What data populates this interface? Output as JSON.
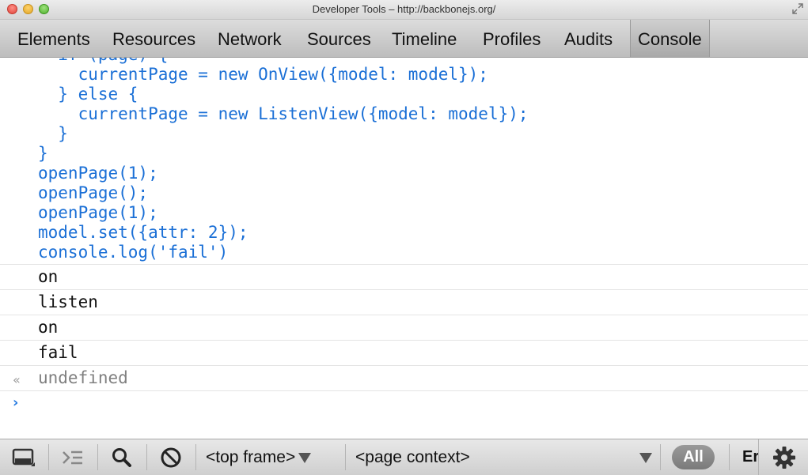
{
  "window": {
    "title": "Developer Tools – http://backbonejs.org/"
  },
  "tabs": [
    {
      "label": "Elements"
    },
    {
      "label": "Resources"
    },
    {
      "label": "Network"
    },
    {
      "label": "Sources"
    },
    {
      "label": "Timeline"
    },
    {
      "label": "Profiles"
    },
    {
      "label": "Audits"
    },
    {
      "label": "Console",
      "active": true
    }
  ],
  "console": {
    "command_lines": [
      "  if (page) {",
      "    currentPage = new OnView({model: model});",
      "  } else {",
      "    currentPage = new ListenView({model: model});",
      "  }",
      "}",
      "openPage(1);",
      "openPage();",
      "openPage(1);",
      "model.set({attr: 2});",
      "console.log('fail')"
    ],
    "log_messages": [
      "on",
      "listen",
      "on",
      "fail"
    ],
    "result": "undefined",
    "colors": {
      "command": "#1a6fd6",
      "result": "#808080",
      "prompt": "#2a7de1"
    }
  },
  "statusbar": {
    "dock_icon": "dock-icon",
    "multiline_icon": "multiline-icon",
    "search_icon": "search-icon",
    "clear_icon": "clear-icon",
    "frame_select": "<top frame>",
    "context_select": "<page context>",
    "filter_all": "All",
    "filter_errors": "Errors",
    "settings_icon": "gear-icon"
  }
}
